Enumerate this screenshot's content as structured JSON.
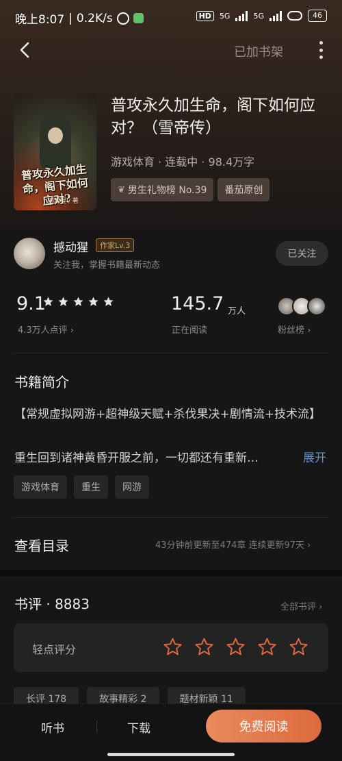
{
  "status_bar": {
    "time": "晚上8:07",
    "speed": "0.2K/s",
    "hd": "HD",
    "net1": "5G",
    "net2": "5G",
    "battery": "46"
  },
  "nav": {
    "back_icon": "chevron-left-icon",
    "shelf_label": "已加书架",
    "more_icon": "more-vertical-icon"
  },
  "book": {
    "cover_title": "普攻永久加生命，阁下如何应对?",
    "cover_author": "撼动猩 / 著",
    "title": "普攻永久加生命，阁下如何应对？（雪帝传）",
    "meta": "游戏体育 · 连载中 · 98.4万字",
    "badges": [
      {
        "icon": "laurel-icon",
        "label": "男生礼物榜 No.39"
      },
      {
        "label": "番茄原创"
      }
    ]
  },
  "author": {
    "name": "撼动猩",
    "level": "作家Lv.3",
    "hint": "关注我，掌握书籍最新动态",
    "follow_label": "已关注"
  },
  "stats": {
    "rating": "9.1",
    "stars": 5,
    "rating_count": "4.3万人点评 ›",
    "reading": "145.7",
    "reading_unit": "万人",
    "reading_label": "正在阅读",
    "fans_label": "粉丝榜 ›"
  },
  "intro": {
    "heading": "书籍简介",
    "line1": "【常规虚拟网游+超神级天赋+杀伐果决+剧情流+技术流】",
    "line2": "重生回到诸神黄昏开服之前，一切都还有重新…",
    "expand": "展开",
    "tags": [
      "游戏体育",
      "重生",
      "网游"
    ]
  },
  "catalog": {
    "heading": "查看目录",
    "info": "43分钟前更新至474章 连续更新97天 ›"
  },
  "reviews": {
    "heading": "书评 · 8883",
    "all_label": "全部书评 ›",
    "rate_label": "轻点评分",
    "rate_star_color": "#e26a3a",
    "tabs": [
      "长评 178",
      "故事精彩 2",
      "题材新颖 11"
    ]
  },
  "bottom_bar": {
    "listen": "听书",
    "download": "下载",
    "read": "免费阅读",
    "accent": "#e07348"
  }
}
